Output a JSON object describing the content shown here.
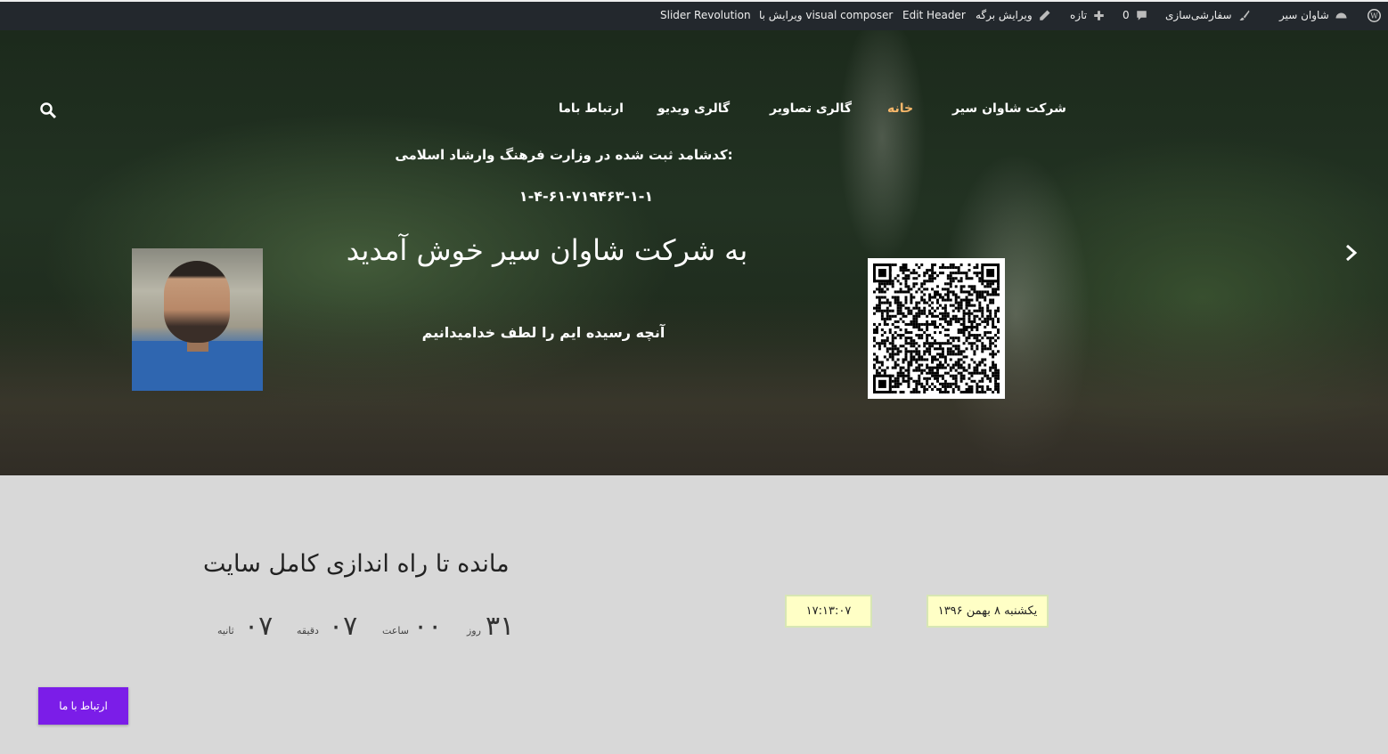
{
  "adminbar": {
    "site_name": "شاوان سیر",
    "customize": "سفارشی‌سازی",
    "comments_count": "0",
    "new": "تازه",
    "edit_page": "ویرایش برگه",
    "edit_header": "Edit Header",
    "visual_composer": "ویرایش با visual composer",
    "slider_revolution": "Slider Revolution"
  },
  "nav": {
    "items": [
      "شرکت شاوان سیر",
      "خانه",
      "گالری تصاویر",
      "گالری ویدیو",
      "ارتباط باما"
    ],
    "active_index": 1,
    "active_color": "#f7b76a"
  },
  "hero": {
    "registration_title": "کدشامد ثبت شده در وزارت فرهنگ وارشاد اسلامی:",
    "registration_code": "۱-۴-۶۱-۷۱۹۴۶۳-۱-۱",
    "welcome": "به شرکت شاوان سیر خوش آمدید",
    "tagline": "آنچه رسیده ایم را لطف خدامیدانیم"
  },
  "countdown": {
    "title": "مانده تا راه اندازی کامل سایت",
    "days_value": "۳۱",
    "days_label": "روز",
    "hours_value": "۰۰",
    "hours_label": "ساعت",
    "minutes_value": "۰۷",
    "minutes_label": "دقیقه",
    "seconds_value": "۰۷",
    "seconds_label": "ثانیه"
  },
  "clock": {
    "time": "۱۷:۱۳:۰۷",
    "date": "یکشنبه ۸ بهمن ۱۳۹۶"
  },
  "contact_button": {
    "label": "ارتباط با ما",
    "color": "#7b1de8"
  }
}
